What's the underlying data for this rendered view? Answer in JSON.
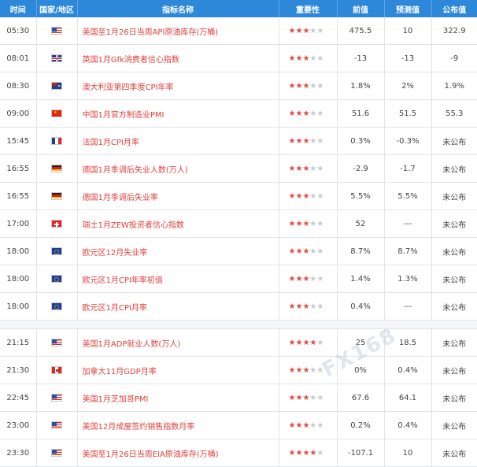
{
  "headers": {
    "time": "时间",
    "region": "国家/地区",
    "name": "指标名称",
    "importance": "重要性",
    "previous": "前值",
    "forecast": "预测值",
    "actual": "公布值"
  },
  "rows": [
    {
      "time": "05:30",
      "flag": "us",
      "name": "美国至1月26日当周API原油库存(万桶)",
      "stars": 3,
      "previous": "475.5",
      "forecast": "10",
      "actual": "322.9"
    },
    {
      "time": "08:01",
      "flag": "uk",
      "name": "英国1月Gfk消费者信心指数",
      "stars": 3,
      "previous": "-13",
      "forecast": "-13",
      "actual": "-9"
    },
    {
      "time": "08:30",
      "flag": "au",
      "name": "澳大利亚第四季度CPI年率",
      "stars": 3,
      "previous": "1.8%",
      "forecast": "2%",
      "actual": "1.9%"
    },
    {
      "time": "09:00",
      "flag": "cn",
      "name": "中国1月官方制造业PMI",
      "stars": 3,
      "previous": "51.6",
      "forecast": "51.5",
      "actual": "55.3"
    },
    {
      "time": "15:45",
      "flag": "fr",
      "name": "法国1月CPI月率",
      "stars": 3,
      "previous": "0.3%",
      "forecast": "-0.3%",
      "actual": "未公布"
    },
    {
      "time": "16:55",
      "flag": "de",
      "name": "德国1月季调后失业人数(万人)",
      "stars": 3,
      "previous": "-2.9",
      "forecast": "-1.7",
      "actual": "未公布"
    },
    {
      "time": "16:55",
      "flag": "de",
      "name": "德国1月季调后失业率",
      "stars": 3,
      "previous": "5.5%",
      "forecast": "5.5%",
      "actual": "未公布"
    },
    {
      "time": "17:00",
      "flag": "ch",
      "name": "瑞士1月ZEW投资者信心指数",
      "stars": 3,
      "previous": "52",
      "forecast": "---",
      "actual": "未公布"
    },
    {
      "time": "18:00",
      "flag": "eu",
      "name": "欧元区12月失业率",
      "stars": 3,
      "previous": "8.7%",
      "forecast": "8.7%",
      "actual": "未公布"
    },
    {
      "time": "18:00",
      "flag": "eu",
      "name": "欧元区1月CPI年率初值",
      "stars": 3,
      "previous": "1.4%",
      "forecast": "1.3%",
      "actual": "未公布"
    },
    {
      "time": "18:00",
      "flag": "eu",
      "name": "欧元区1月CPI月率",
      "stars": 3,
      "previous": "0.4%",
      "forecast": "---",
      "actual": "未公布"
    },
    {
      "separator": true
    },
    {
      "time": "21:15",
      "flag": "us",
      "name": "美国1月ADP就业人数(万人)",
      "stars": 4,
      "previous": "25",
      "forecast": "18.5",
      "actual": "未公布"
    },
    {
      "time": "21:30",
      "flag": "ca",
      "name": "加拿大11月GDP月率",
      "stars": 3,
      "previous": "0%",
      "forecast": "0.4%",
      "actual": "未公布"
    },
    {
      "time": "22:45",
      "flag": "us",
      "name": "美国1月芝加哥PMI",
      "stars": 3,
      "previous": "67.6",
      "forecast": "64.1",
      "actual": "未公布"
    },
    {
      "time": "23:00",
      "flag": "us",
      "name": "美国12月成屋签约销售指数月率",
      "stars": 3,
      "previous": "0.2%",
      "forecast": "0.4%",
      "actual": "未公布"
    },
    {
      "time": "23:30",
      "flag": "us",
      "name": "美国至1月26日当周EIA原油库存(万桶)",
      "stars": 4,
      "previous": "-107.1",
      "forecast": "10",
      "actual": "未公布"
    }
  ],
  "watermark": "FX168"
}
